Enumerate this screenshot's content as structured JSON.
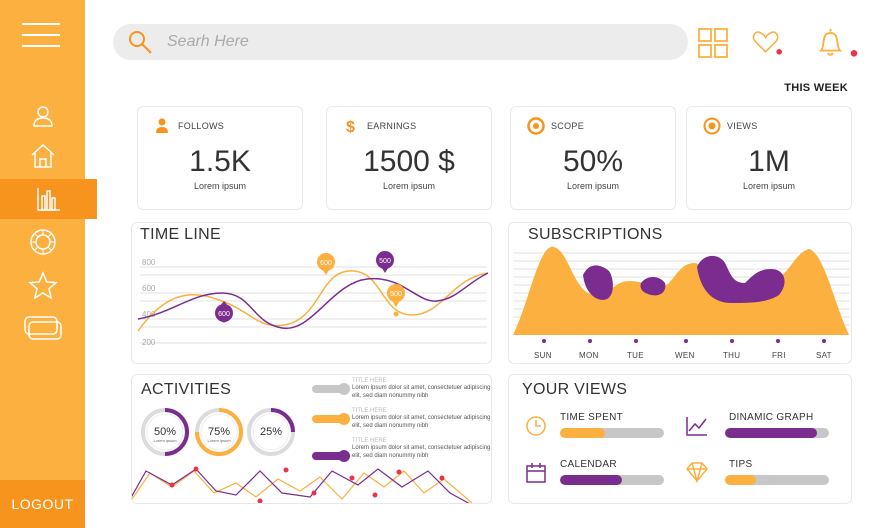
{
  "search": {
    "placeholder": "Searh Here"
  },
  "header": {
    "period": "THIS WEEK"
  },
  "sidebar": {
    "logout_label": "LOGOUT"
  },
  "stats": [
    {
      "label": "FOLLOWS",
      "value": "1.5K",
      "sub": "Lorem ipsum",
      "icon": "user-icon"
    },
    {
      "label": "EARNINGS",
      "value": "1500 $",
      "sub": "Lorem ipsum",
      "icon": "dollar-icon"
    },
    {
      "label": "SCOPE",
      "value": "50%",
      "sub": "Lorem ipsum",
      "icon": "target-icon"
    },
    {
      "label": "VIEWS",
      "value": "1M",
      "sub": "Lorem ipsum",
      "icon": "eye-icon"
    }
  ],
  "timeline": {
    "title": "TIME LINE",
    "y_ticks": [
      "800",
      "600",
      "400",
      "200"
    ],
    "markers": [
      "600",
      "600",
      "500",
      "500"
    ]
  },
  "subscriptions": {
    "title": "SUBSCRIPTIONS",
    "days": [
      "SUN",
      "MON",
      "TUE",
      "WEN",
      "THU",
      "FRI",
      "SAT"
    ]
  },
  "activities": {
    "title": "ACTIVITIES",
    "rings": [
      {
        "label": "50%",
        "sub": "Lorem ipsum",
        "fraction": 0.5,
        "color": "#7b2c8f"
      },
      {
        "label": "75%",
        "sub": "Lorem ipsum",
        "fraction": 0.75,
        "color": "#fbb040"
      },
      {
        "label": "25%",
        "sub": "",
        "fraction": 0.25,
        "color": "#7b2c8f"
      }
    ],
    "legend": [
      {
        "title": "TITLE HERE",
        "text": "Lorem ipsum dolor sit amet, consectetuer adipiscing elit, sed diam nonummy nibh",
        "color": "#c7c7c7"
      },
      {
        "title": "TITLE HERE",
        "text": "Lorem ipsum dolor sit amet, consectetuer adipiscing elit, sed diam nonummy nibh",
        "color": "#fbb040"
      },
      {
        "title": "TITLE HERE",
        "text": "Lorem ipsum dolor sit amet, consectetuer adipiscing elit, sed diam nonummy nibh",
        "color": "#7b2c8f"
      }
    ]
  },
  "your_views": {
    "title": "YOUR VIEWS",
    "items": [
      {
        "label": "TIME SPENT",
        "fraction": 0.43,
        "color": "#fbb040",
        "icon": "clock-icon"
      },
      {
        "label": "DINAMIC GRAPH",
        "fraction": 0.88,
        "color": "#7b2c8f",
        "icon": "line-graph-icon"
      },
      {
        "label": "CALENDAR",
        "fraction": 0.6,
        "color": "#7b2c8f",
        "icon": "calendar-icon"
      },
      {
        "label": "TIPS",
        "fraction": 0.3,
        "color": "#fbb040",
        "icon": "diamond-icon"
      }
    ]
  },
  "colors": {
    "orange": "#fbb040",
    "dark_orange": "#f7941d",
    "purple": "#7b2c8f",
    "grey": "#c7c7c7",
    "red_dot": "#e8334a"
  }
}
